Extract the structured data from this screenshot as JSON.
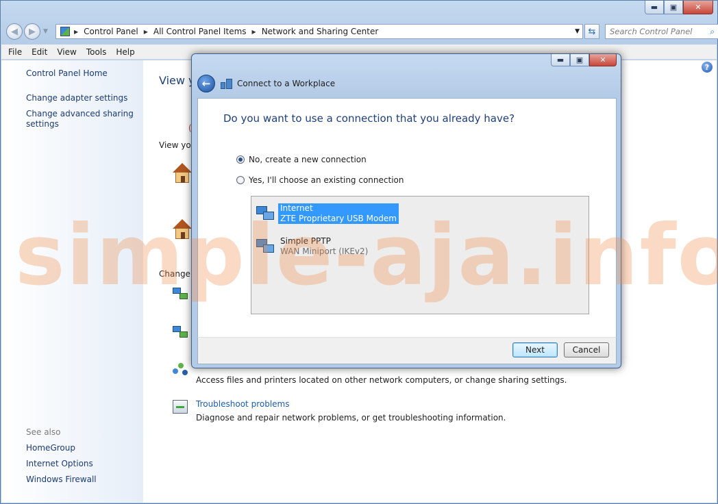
{
  "window": {
    "minimize": "▬",
    "maximize": "▣",
    "close": "✕"
  },
  "address": {
    "crumbs": [
      "Control Panel",
      "All Control Panel Items",
      "Network and Sharing Center"
    ]
  },
  "search": {
    "placeholder": "Search Control Panel"
  },
  "menu": [
    "File",
    "Edit",
    "View",
    "Tools",
    "Help"
  ],
  "sidebar": {
    "items": [
      "Control Panel Home",
      "Change adapter settings",
      "Change advanced sharing settings"
    ],
    "see_also_label": "See also",
    "see_also": [
      "HomeGroup",
      "Internet Options",
      "Windows Firewall"
    ]
  },
  "background": {
    "heading_fragment": "View you",
    "networks_fragment": "View you",
    "paren_fragment": "(",
    "change_fragment": "Change y",
    "homegroup_desc": "Access files and printers located on other network computers, or change sharing settings.",
    "troubleshoot_link": "Troubleshoot problems",
    "troubleshoot_desc": "Diagnose and repair network problems, or get troubleshooting information."
  },
  "dialog": {
    "title": "Connect to a Workplace",
    "question": "Do you want to use a connection that you already have?",
    "options": [
      {
        "label": "No, create a new connection",
        "selected": true
      },
      {
        "label": "Yes, I'll choose an existing connection",
        "selected": false
      }
    ],
    "connections": [
      {
        "name": "Internet",
        "device": "ZTE Proprietary USB Modem",
        "selected": true
      },
      {
        "name": "Simple PPTP",
        "device": "WAN Miniport (IKEv2)",
        "selected": false
      }
    ],
    "next_label": "Next",
    "cancel_label": "Cancel"
  },
  "watermark": "simple-aja.info",
  "colors": {
    "accent": "#1e3f7a",
    "link": "#1c5bb0",
    "selection": "#3399ff",
    "watermark": "#f08c46"
  }
}
